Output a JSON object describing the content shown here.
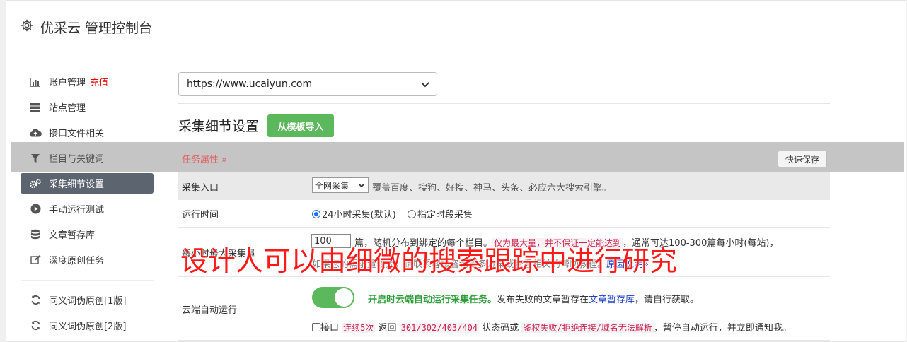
{
  "header": {
    "title": "优采云 管理控制台",
    "icon": "gear-icon"
  },
  "sidebar": {
    "items": [
      {
        "label": "账户管理",
        "extra": "充值",
        "icon": "bar-chart-icon"
      },
      {
        "label": "站点管理",
        "icon": "server-icon"
      },
      {
        "label": "接口文件相关",
        "icon": "cloud-upload-icon"
      },
      {
        "label": "栏目与关键词",
        "icon": "filter-icon"
      },
      {
        "label": "采集细节设置",
        "icon": "gears-icon",
        "active": true
      },
      {
        "label": "手动运行测试",
        "icon": "play-circle-icon"
      },
      {
        "label": "文章暂存库",
        "icon": "database-icon"
      },
      {
        "label": "深度原创任务",
        "icon": "edit-icon"
      },
      {
        "label": "同义词伪原创[1版]",
        "icon": "refresh-icon"
      },
      {
        "label": "同义词伪原创[2版]",
        "icon": "refresh-icon"
      }
    ]
  },
  "main": {
    "site_select": "https://www.ucaiyun.com",
    "section_title": "采集细节设置",
    "import_button": "从模板导入",
    "task_attr": "任务属性 »",
    "quick_save": "快速保存",
    "entry": {
      "label": "采集入口",
      "select": "全网采集",
      "desc": "覆盖百度、搜狗、好搜、神马、头条、必应六大搜索引擎。"
    },
    "run_time": {
      "label": "运行时间",
      "option1": "24小时采集(默认)",
      "option2": "指定时段采集"
    },
    "max_collect": {
      "label": "每小时最大采集量",
      "value": "100",
      "text1": "篇，随机分布到绑定的每个栏目。",
      "warn": "仅为最大量，并不保证一定能达到",
      "text2": "，通常可达100-300篇每小时(每站)，",
      "text3": "如果您的需求量较大，请联系客服咨询更多方案或查看相关的帮助教程。",
      "link": "原因说明»"
    },
    "cloud_run": {
      "label": "云端自动运行",
      "green": "开启时云端自动运行采集任务。",
      "text1": "发布失败的文章暂存在",
      "link": "文章暂存库",
      "text2": "，请自行获取。",
      "cb_label": "接口",
      "warn1": "连续5次",
      "text3": "返回",
      "warn2": "301/302/403/404",
      "text4": "状态码或",
      "warn3": "鉴权失败/拒绝连接/域名无法解析",
      "text5": "，暂停自动运行，并立即通知我。"
    }
  },
  "overlay_text": "设计人可以由细微的搜索跟踪中进行研究",
  "colors": {
    "accent_green": "#5cb85c",
    "active_sidebar": "#5c6470",
    "overlay_red": "#ff1a1a"
  }
}
